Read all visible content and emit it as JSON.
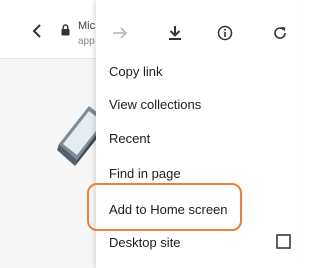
{
  "browser": {
    "url_title": "Mic",
    "url_subtitle": "app"
  },
  "toolbar": {
    "icons": [
      "forward-icon",
      "download-icon",
      "info-icon",
      "refresh-icon"
    ]
  },
  "menu": {
    "items": [
      {
        "label": "Copy link"
      },
      {
        "label": "View collections"
      },
      {
        "label": "Recent"
      },
      {
        "label": "Find in page"
      },
      {
        "label": "Add to Home screen"
      },
      {
        "label": "Desktop site"
      }
    ],
    "highlighted_item": "Add to Home screen",
    "desktop_site_checked": false
  },
  "colors": {
    "highlight": "#e8823a",
    "text": "#202020",
    "icon": "#555555"
  }
}
